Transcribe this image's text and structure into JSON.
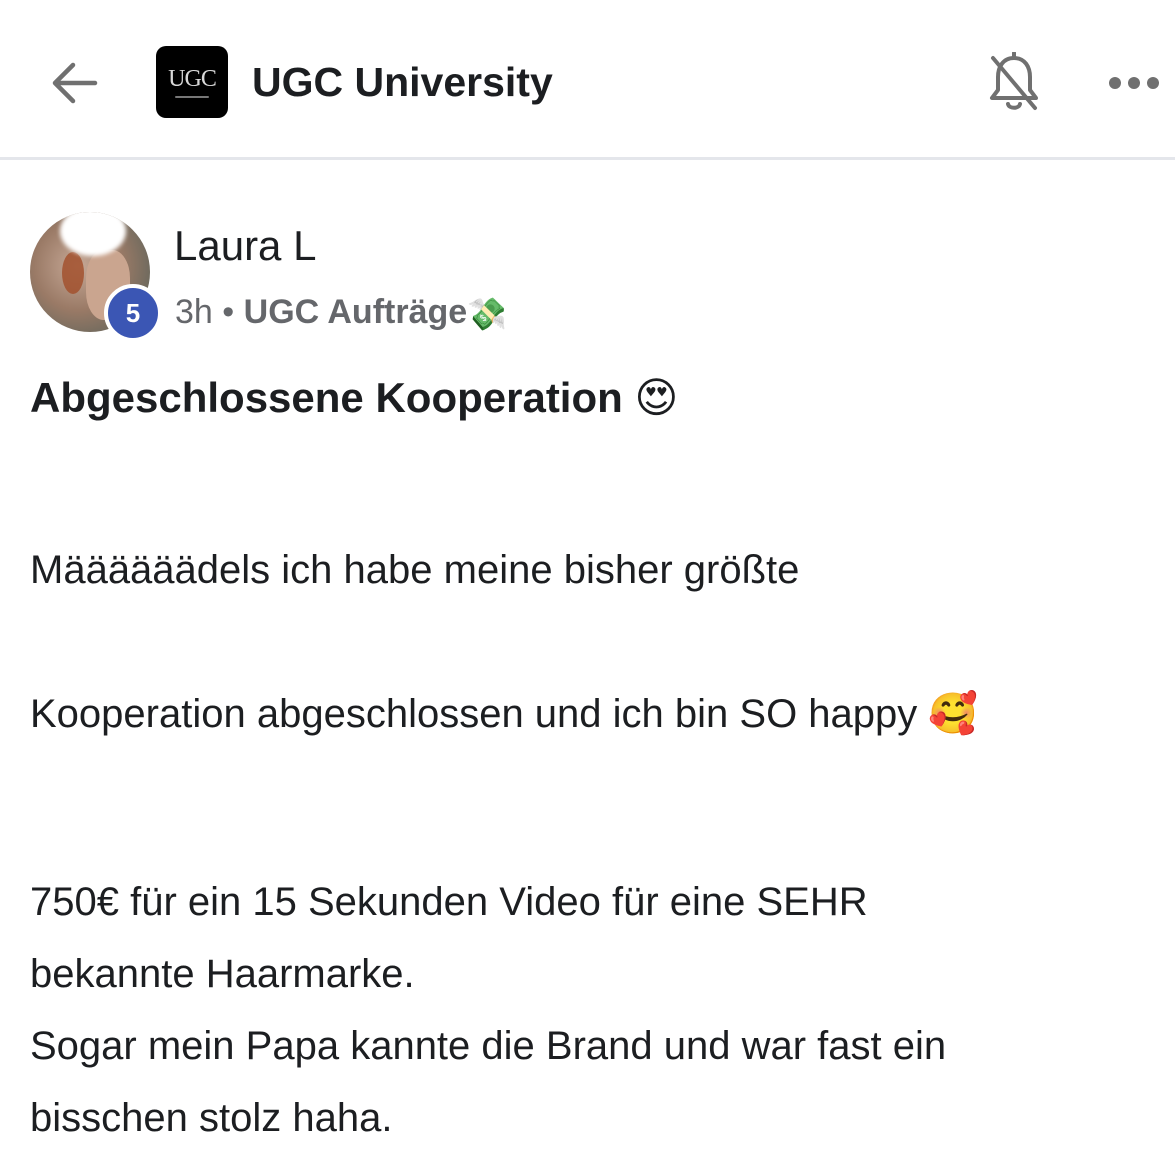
{
  "header": {
    "group_name": "UGC University",
    "logo_text": "UGC",
    "icons": {
      "back": "arrow-left-icon",
      "notifications": "bell-off-icon",
      "more": "more-horizontal-icon"
    }
  },
  "post": {
    "author": "Laura L",
    "level": "5",
    "time": "3h",
    "separator": "•",
    "topic": "UGC Aufträge",
    "topic_emoji": "💸",
    "title": "Abgeschlossene Kooperation",
    "title_emoji": "😍",
    "body_line_1": "Määäääädels ich habe meine bisher größte",
    "body_line_2": "Kooperation abgeschlossen und ich bin SO happy",
    "body_line_2_emoji": "🥰",
    "body_para_2": "750€ für ein 15 Sekunden Video für eine SEHR\nbekannte Haarmarke.\nSogar mein Papa kannte die Brand und war fast ein\nbisschen stolz haha."
  },
  "colors": {
    "level_badge": "#3b56b4",
    "text_primary": "#1c1e21",
    "text_secondary": "#65676b",
    "divider": "#e4e6eb"
  }
}
